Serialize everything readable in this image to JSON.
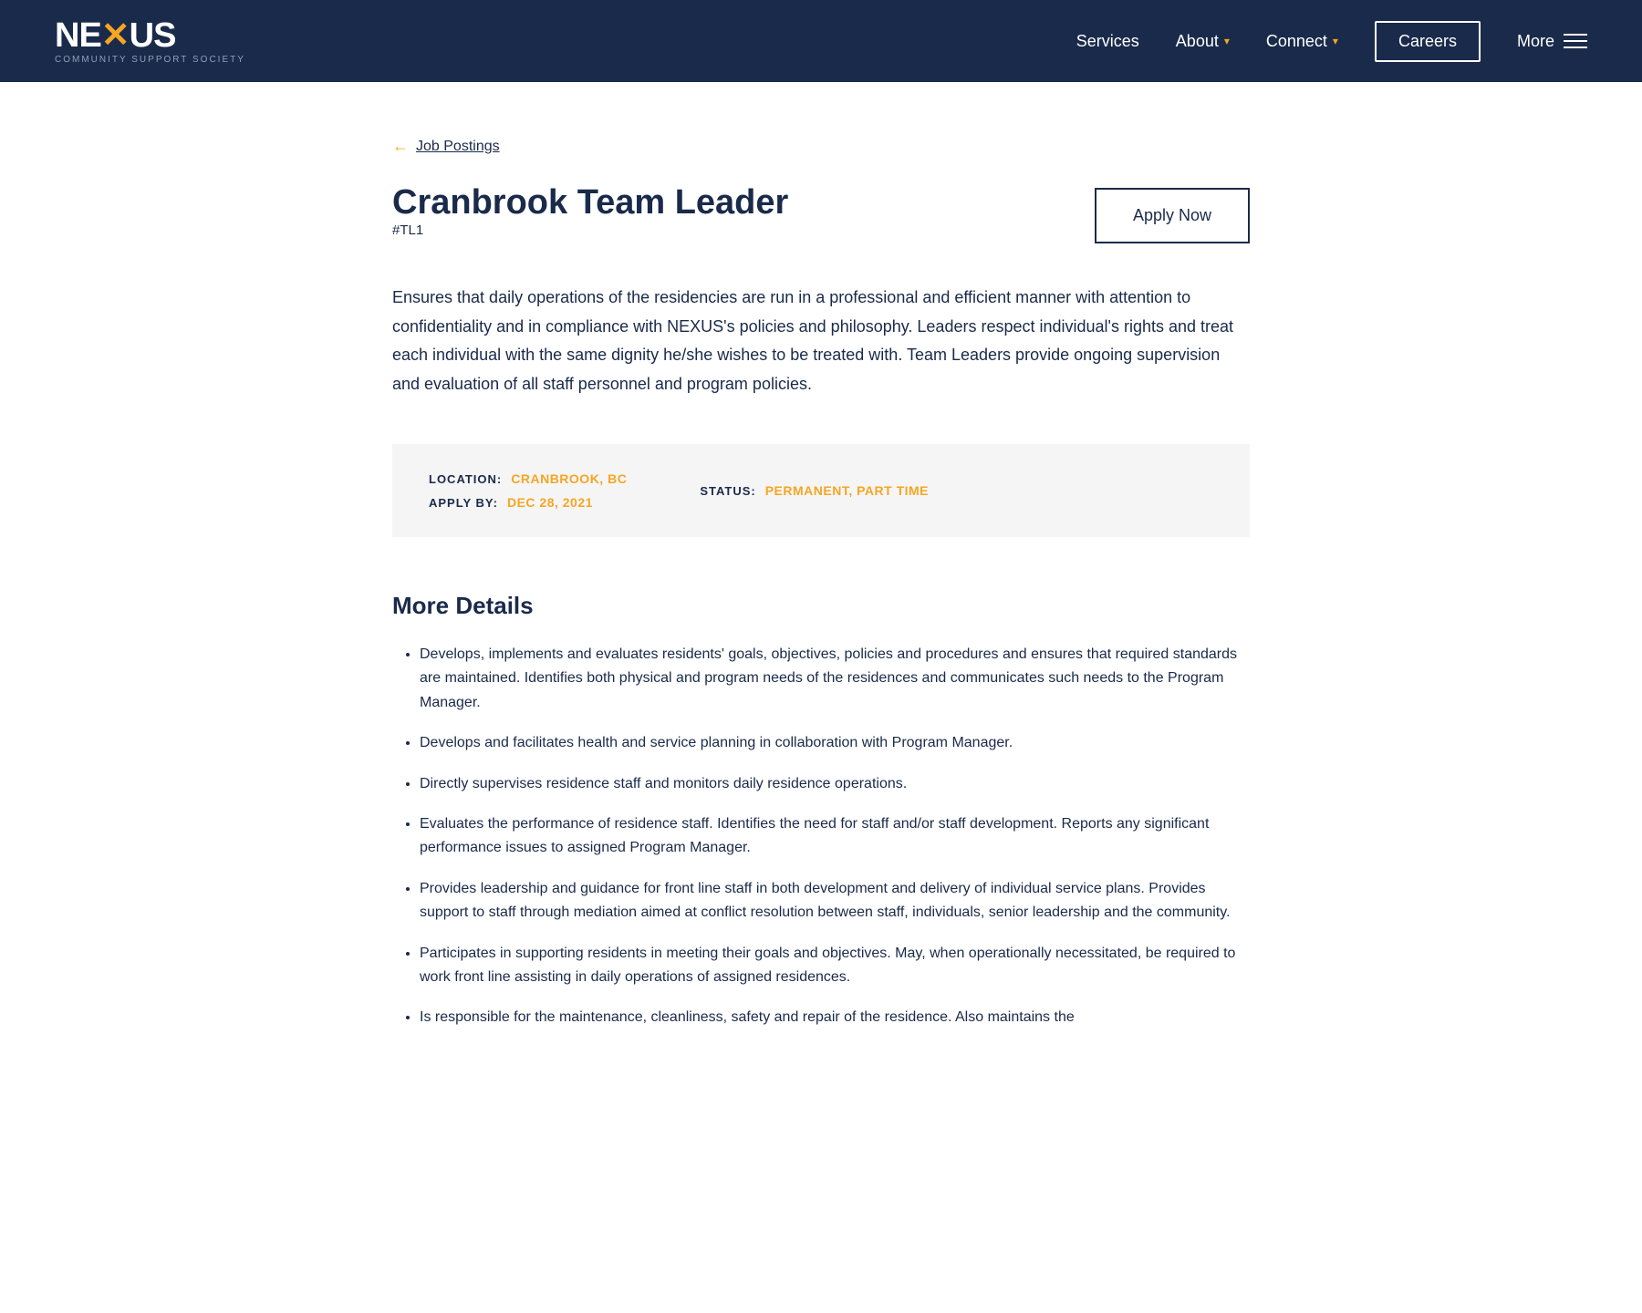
{
  "header": {
    "logo": {
      "name": "NEXUS",
      "subtitle": "COMMUNITY SUPPORT SOCIETY"
    },
    "nav": {
      "items": [
        {
          "label": "Services",
          "hasDropdown": false
        },
        {
          "label": "About",
          "hasDropdown": true
        },
        {
          "label": "Connect",
          "hasDropdown": true
        },
        {
          "label": "Careers",
          "isButton": true
        },
        {
          "label": "More",
          "hasHamburger": true
        }
      ]
    }
  },
  "breadcrumb": {
    "arrow": "←",
    "label": "Job Postings"
  },
  "job": {
    "title": "Cranbrook Team Leader",
    "id": "#TL1",
    "apply_label": "Apply Now",
    "description": "Ensures that daily operations of the residencies are run in a professional and efficient manner with attention to confidentiality and in compliance with NEXUS's policies and philosophy. Leaders respect individual's rights and treat each individual with the same dignity he/she wishes to be treated with. Team Leaders provide ongoing supervision and evaluation of all staff personnel and program policies.",
    "meta": {
      "location_label": "LOCATION:",
      "location_value": "CRANBROOK, BC",
      "apply_by_label": "APPLY BY:",
      "apply_by_value": "DEC 28, 2021",
      "status_label": "STATUS:",
      "status_value": "PERMANENT, PART TIME"
    },
    "more_details": {
      "title": "More Details",
      "items": [
        "Develops, implements and evaluates residents' goals, objectives, policies and procedures and ensures that required standards are maintained. Identifies both physical and program needs of the residences and communicates such needs to the Program Manager.",
        "Develops and facilitates health and service planning in collaboration with Program Manager.",
        "Directly supervises residence staff and monitors daily residence operations.",
        "Evaluates the performance of residence staff. Identifies the need for staff and/or staff development. Reports any significant performance issues to assigned Program Manager.",
        "Provides leadership and guidance for front line staff in both development and delivery of individual service plans. Provides support to staff through mediation aimed at conflict resolution between staff, individuals, senior leadership and the community.",
        "Participates in supporting residents in meeting their goals and objectives. May, when operationally necessitated, be required to work front line assisting in daily operations of assigned residences.",
        "Is responsible for the maintenance, cleanliness, safety and repair of the residence. Also maintains the"
      ]
    }
  }
}
